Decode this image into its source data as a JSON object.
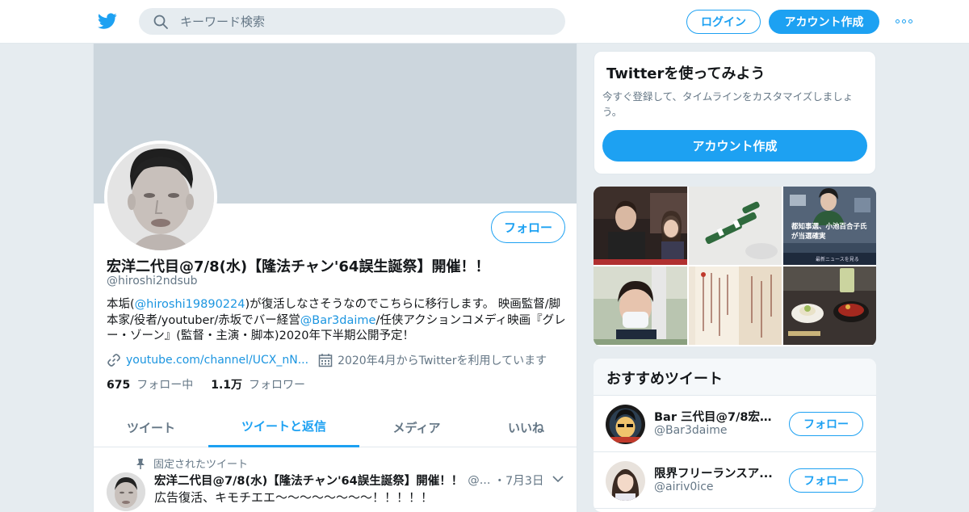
{
  "topbar": {
    "search_placeholder": "キーワード検索",
    "login_label": "ログイン",
    "signup_label": "アカウント作成"
  },
  "profile": {
    "name": "宏洋二代目@7/8(水)【隆法チャン'64誤生誕祭】開催！！",
    "handle": "@hiroshi2ndsub",
    "follow_label": "フォロー",
    "bio": {
      "t1": "本垢(",
      "m1": "@hiroshi19890224",
      "t2": ")が復活しなさそうなのでこちらに移行します。 映画監督/脚本家/役者/youtuber/赤坂でバー経営",
      "m2": "@Bar3daime",
      "t3": "/任侠アクションコメディ映画『グレー・ゾーン』(監督・主演・脚本)2020年下半期公開予定！"
    },
    "link": "youtube.com/channel/UCX_nN...",
    "joined": "2020年4月からTwitterを利用しています",
    "following_count": "675",
    "following_label": "フォロー中",
    "followers_count": "1.1万",
    "followers_label": "フォロワー",
    "tabs": [
      {
        "label": "ツイート"
      },
      {
        "label": "ツイートと返信"
      },
      {
        "label": "メディア"
      },
      {
        "label": "いいね"
      }
    ],
    "pinned_label": "固定されたツイート",
    "tweet": {
      "name": "宏洋二代目@7/8(水)【隆法チャン'64誤生誕祭】開催！！",
      "handle": "@...",
      "date": "・7月3日",
      "text": "広告復活、キモチエエ〜〜〜〜〜〜〜〜！！！！！"
    }
  },
  "sidebar": {
    "signup_card": {
      "title": "Twitterを使ってみよう",
      "desc": "今すぐ登録して、タイムラインをカスタマイズしましょう。",
      "cta": "アカウント作成"
    },
    "photos": {
      "news_line1": "都知事選、小池百合子氏",
      "news_line2": "が当選確実",
      "news_footer": "最新ニュースを見る"
    },
    "recommended": {
      "title": "おすすめツイート",
      "items": [
        {
          "name": "Bar 三代目@7/8宏洋...",
          "handle": "@Bar3daime",
          "follow": "フォロー"
        },
        {
          "name": "限界フリーランスア...",
          "handle": "@airiv0ice",
          "follow": "フォロー"
        }
      ]
    }
  },
  "colors": {
    "accent": "#1da1f2",
    "banner": "#ccd6dd",
    "muted": "#657786"
  }
}
